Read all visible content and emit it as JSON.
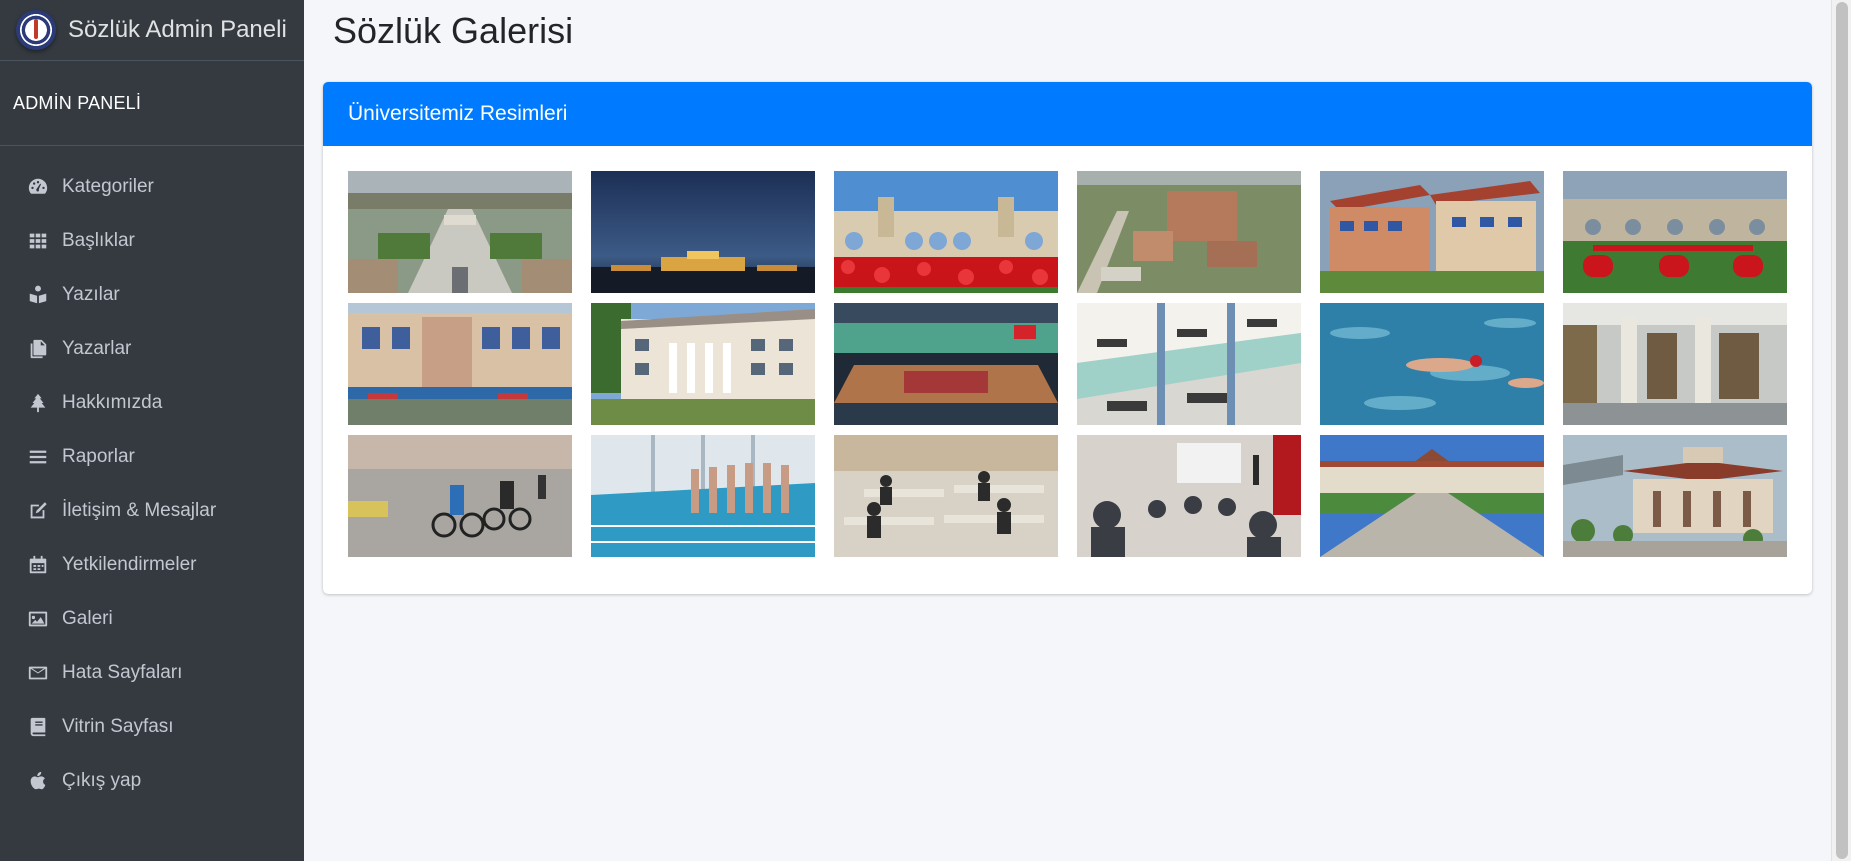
{
  "brand": {
    "title": "Sözlük Admin Paneli",
    "logo_icon": "university-seal-icon"
  },
  "sidebar": {
    "user_label": "ADMİN PANELİ",
    "items": [
      {
        "label": "Kategoriler",
        "icon": "dashboard-gauge-icon"
      },
      {
        "label": "Başlıklar",
        "icon": "grid-icon"
      },
      {
        "label": "Yazılar",
        "icon": "book-reader-icon"
      },
      {
        "label": "Yazarlar",
        "icon": "copy-documents-icon"
      },
      {
        "label": "Hakkımızda",
        "icon": "tree-icon"
      },
      {
        "label": "Raporlar",
        "icon": "bars-icon"
      },
      {
        "label": "İletişim & Mesajlar",
        "icon": "edit-square-icon"
      },
      {
        "label": "Yetkilendirmeler",
        "icon": "calendar-icon"
      },
      {
        "label": "Galeri",
        "icon": "image-icon"
      },
      {
        "label": "Hata Sayfaları",
        "icon": "envelope-icon"
      },
      {
        "label": "Vitrin Sayfası",
        "icon": "book-icon"
      },
      {
        "label": "Çıkış yap",
        "icon": "apple-icon"
      }
    ]
  },
  "page": {
    "title": "Sözlük Galerisi"
  },
  "card": {
    "title": "Üniversitemiz Resimleri"
  },
  "gallery": {
    "images": [
      {
        "subject": "aerial-campus-icon"
      },
      {
        "subject": "night-campus-icon"
      },
      {
        "subject": "arch-gate-tulips-icon"
      },
      {
        "subject": "aerial-buildings-icon"
      },
      {
        "subject": "faculty-building-icon"
      },
      {
        "subject": "gate-garden-dpu-icon"
      },
      {
        "subject": "building-market-icon"
      },
      {
        "subject": "columned-building-icon"
      },
      {
        "subject": "sports-hall-icon"
      },
      {
        "subject": "atrium-interior-icon"
      },
      {
        "subject": "swimmer-pool-icon"
      },
      {
        "subject": "library-shelves-icon"
      },
      {
        "subject": "cyclists-race-icon"
      },
      {
        "subject": "pool-swimmers-line-icon"
      },
      {
        "subject": "study-room-icon"
      },
      {
        "subject": "lecture-hall-icon"
      },
      {
        "subject": "campus-walkway-icon"
      },
      {
        "subject": "pavilion-building-icon"
      }
    ]
  }
}
